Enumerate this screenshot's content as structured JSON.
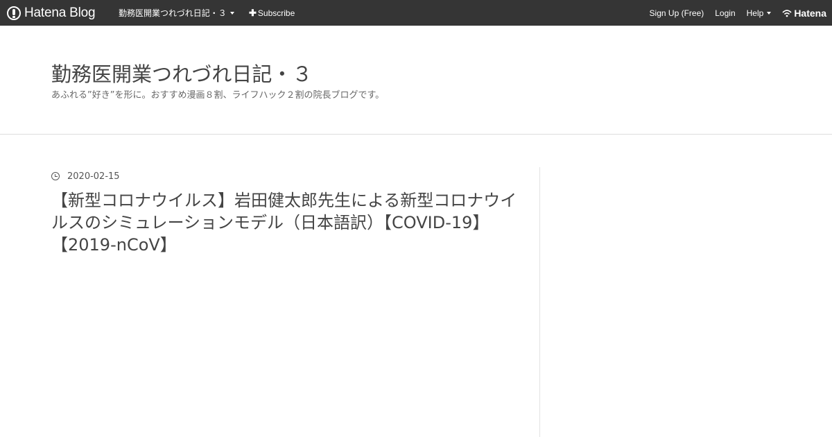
{
  "topbar": {
    "brand": "Hatena Blog",
    "blog_name": "勤務医開業つれづれ日記・３",
    "subscribe": "Subscribe",
    "signup": "Sign Up (Free)",
    "login": "Login",
    "help": "Help",
    "hatena": "Hatena"
  },
  "header": {
    "title": "勤務医開業つれづれ日記・３",
    "description": "あふれる”好き”を形に。おすすめ漫画８割、ライフハック２割の院長ブログです。"
  },
  "entry": {
    "date": "2020-02-15",
    "title": "【新型コロナウイルス】岩田健太郎先生による新型コロナウイルスのシミュレーションモデル（日本語訳）【COVID-19】【2019-nCoV】"
  }
}
